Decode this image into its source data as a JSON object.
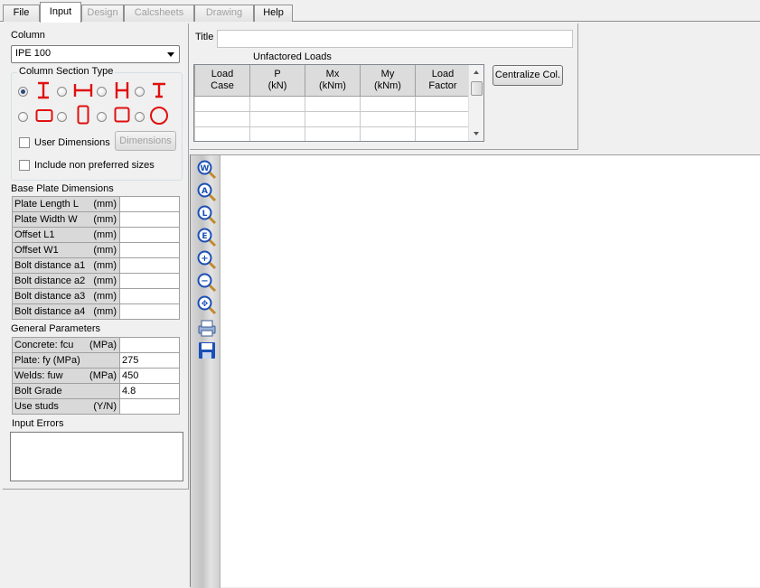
{
  "tabs": [
    {
      "label": "File",
      "state": "normal"
    },
    {
      "label": "Input",
      "state": "active"
    },
    {
      "label": "Design",
      "state": "disabled"
    },
    {
      "label": "Calcsheets",
      "state": "disabled"
    },
    {
      "label": "Drawing",
      "state": "disabled"
    },
    {
      "label": "Help",
      "state": "normal"
    }
  ],
  "column": {
    "label": "Column",
    "selected": "IPE 100",
    "section_type_label": "Column Section Type",
    "user_dimensions_label": "User Dimensions",
    "dimensions_button": "Dimensions",
    "non_preferred_label": "Include non preferred sizes",
    "section_shapes": [
      "I-section",
      "H-section-horizontal",
      "H-section",
      "T-section",
      "rectangular-hollow",
      "rectangular-hollow-tall",
      "square-hollow",
      "circular-hollow"
    ],
    "selected_shape": "I-section"
  },
  "base_plate": {
    "label": "Base Plate Dimensions",
    "rows": [
      {
        "name": "Plate Length L",
        "unit": "(mm)",
        "value": ""
      },
      {
        "name": "Plate Width W",
        "unit": "(mm)",
        "value": ""
      },
      {
        "name": "Offset L1",
        "unit": "(mm)",
        "value": ""
      },
      {
        "name": "Offset W1",
        "unit": "(mm)",
        "value": ""
      },
      {
        "name": "Bolt distance a1",
        "unit": "(mm)",
        "value": ""
      },
      {
        "name": "Bolt distance a2",
        "unit": "(mm)",
        "value": ""
      },
      {
        "name": "Bolt distance a3",
        "unit": "(mm)",
        "value": ""
      },
      {
        "name": "Bolt distance a4",
        "unit": "(mm)",
        "value": ""
      }
    ]
  },
  "general": {
    "label": "General Parameters",
    "rows": [
      {
        "name": "Concrete: fcu",
        "unit": "(MPa)",
        "value": ""
      },
      {
        "name": "Plate: fy (MPa)",
        "unit": "",
        "value": "275"
      },
      {
        "name": "Welds: fuw",
        "unit": "(MPa)",
        "value": "450"
      },
      {
        "name": "Bolt Grade",
        "unit": "",
        "value": "4.8"
      },
      {
        "name": "Use studs",
        "unit": "(Y/N)",
        "value": ""
      }
    ]
  },
  "errors": {
    "label": "Input Errors",
    "text": ""
  },
  "title_field": {
    "label": "Title",
    "value": ""
  },
  "loads": {
    "caption": "Unfactored Loads",
    "headers": [
      [
        "Load",
        "Case"
      ],
      [
        "P",
        "(kN)"
      ],
      [
        "Mx",
        "(kNm)"
      ],
      [
        "My",
        "(kNm)"
      ],
      [
        "Load",
        "Factor"
      ]
    ],
    "rows": [
      [
        "",
        "",
        "",
        "",
        ""
      ],
      [
        "",
        "",
        "",
        "",
        ""
      ],
      [
        "",
        "",
        "",
        "",
        ""
      ]
    ]
  },
  "centralize_button": "Centralize Col.",
  "tools": [
    "zoom-width-icon",
    "zoom-all-icon",
    "zoom-length-icon",
    "zoom-extents-icon",
    "zoom-in-icon",
    "zoom-out-icon",
    "pan-icon",
    "print-icon",
    "save-icon"
  ],
  "tool_letters": [
    "W",
    "A",
    "L",
    "E",
    "+",
    "−",
    "✥",
    "",
    ""
  ],
  "colors": {
    "shape_red": "#e01010",
    "tool_blue": "#1a4fb5",
    "radio_dot": "#2b4a79"
  }
}
